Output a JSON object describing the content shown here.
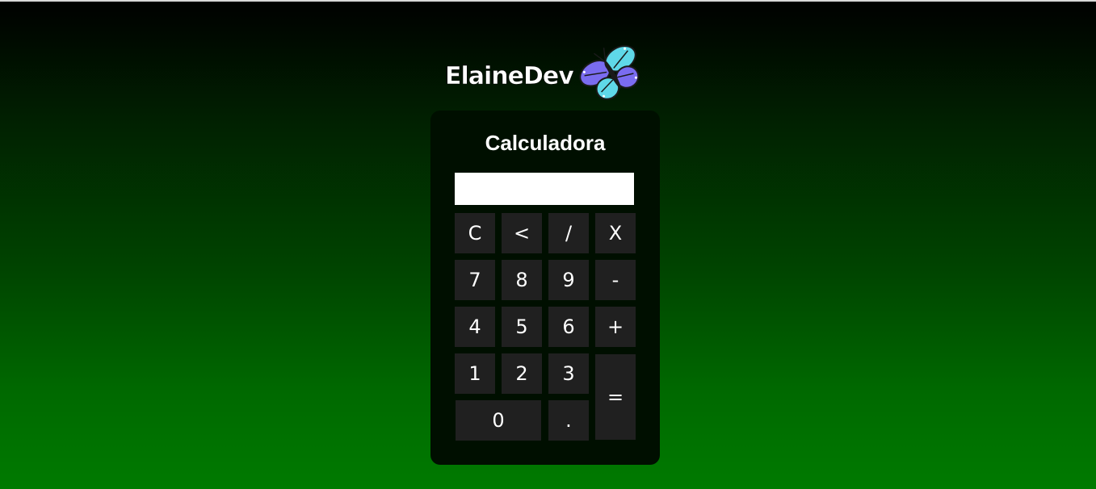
{
  "brand": {
    "name": "ElaineDev",
    "logo_icon": "butterfly-icon",
    "logo_colors": [
      "#5fd8e8",
      "#7a6cf0",
      "#1a1a1a"
    ]
  },
  "calculator": {
    "title": "Calculadora",
    "display_value": "",
    "keys": [
      "C",
      "<",
      "/",
      "X",
      "7",
      "8",
      "9",
      "-",
      "4",
      "5",
      "6",
      "+",
      "1",
      "2",
      "3",
      "=",
      "0",
      "."
    ]
  },
  "colors": {
    "background_top": "#000000",
    "background_bottom": "#007a00",
    "panel": "#000f00",
    "key": "#202020",
    "key_text": "#ffffff"
  }
}
